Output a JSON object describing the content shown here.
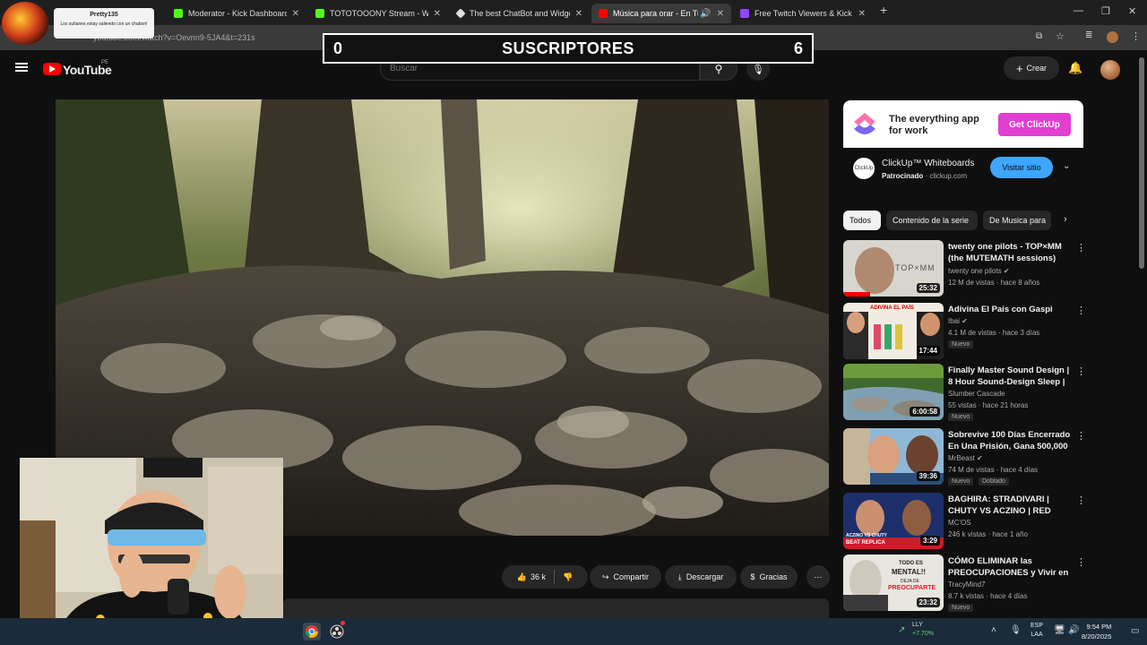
{
  "browser": {
    "tabs": [
      {
        "label": "Moderator - Kick Dashboard",
        "favicon_color": "#53fc18"
      },
      {
        "label": "TOTOTOOONY Stream - Watch",
        "favicon_color": "#53fc18"
      },
      {
        "label": "The best ChatBot and Widgets",
        "favicon_color": "#dddddd"
      },
      {
        "label": "Música para orar - En Tu p",
        "favicon_color": "#ff0000"
      },
      {
        "label": "Free Twitch Viewers & Kick Vie",
        "favicon_color": "#9146ff"
      }
    ],
    "url": "youtube.com/watch?v=Oevnn9-5JA4&t=231s"
  },
  "overlay": {
    "streamer_name": "Pretty135",
    "streamer_message": "Los sultanes estay saliendo con un chabon!",
    "sub_current": "0",
    "sub_label": "SUSCRIPTORES",
    "sub_goal": "6"
  },
  "youtube": {
    "brand": "YouTube",
    "country": "PE",
    "search_placeholder": "Buscar",
    "create_label": "Crear"
  },
  "actions": {
    "likes": "36 k",
    "share": "Compartir",
    "download": "Descargar",
    "thanks": "Gracias"
  },
  "ad": {
    "tagline": "The everything app for work",
    "cta": "Get ClickUp",
    "icon_text": "ClickUp",
    "title": "ClickUp™ Whiteboards",
    "sponsored": "Patrocinado",
    "domain": "clickup.com",
    "visit": "Visitar sitio"
  },
  "chips": [
    "Todos",
    "Contenido de la serie",
    "De Musica para"
  ],
  "recommendations": [
    {
      "title": "twenty one pilots - TOP×MM (the MUTEMATH sessions)",
      "channel": "twenty one pilots",
      "verified": true,
      "meta": "12 M de vistas · hace 8 años",
      "duration": "25:32",
      "badges": []
    },
    {
      "title": "Adivina El País con Gaspi",
      "channel": "Ibai",
      "verified": true,
      "meta": "4.1 M de vistas · hace 3 días",
      "duration": "17:44",
      "badges": [
        "Nuevo"
      ]
    },
    {
      "title": "Finally Master Sound Design | 8 Hour Sound-Design Sleep | ...",
      "channel": "Slumber Cascade",
      "verified": false,
      "meta": "55 vistas · hace 21 horas",
      "duration": "6:00:58",
      "badges": [
        "Nuevo"
      ]
    },
    {
      "title": "Sobrevive 100 Días Encerrado En Una Prisión, Gana 500,000 ...",
      "channel": "MrBeast",
      "verified": true,
      "meta": "74 M de vistas · hace 4 días",
      "duration": "39:36",
      "badges": [
        "Nuevo",
        "Doblado"
      ]
    },
    {
      "title": "BAGHIRA: STRADIVARI | CHUTY VS ACZINO | RED BULL ...",
      "channel": "MC'OS",
      "verified": false,
      "meta": "246 k vistas · hace 1 año",
      "duration": "3:29",
      "badges": []
    },
    {
      "title": "CÓMO ELIMINAR las PREOCUPACIONES y Vivir en ...",
      "channel": "TracyMind7",
      "verified": false,
      "meta": "8.7 k vistas · hace 4 días",
      "duration": "23:32",
      "badges": [
        "Nuevo"
      ]
    }
  ],
  "thumb_texts": {
    "t0": "TOP×MM",
    "t1": "ADIVINA EL PAÍS",
    "t4a": "ACZINO VS CHUTY",
    "t4b": "BEAT REPLICA",
    "t5a": "TODO ES",
    "t5b": "MENTAL!!",
    "t5c": "DEJA DE",
    "t5d": "PREOCUPARTE"
  },
  "taskbar": {
    "ticker_symbol": "LLY",
    "ticker_change": "+7.70%",
    "lang_top": "ESP",
    "lang_bottom": "LAA",
    "time": "9:54 PM",
    "date": "8/20/2025"
  },
  "colors": {
    "accent": "#3ea6ff",
    "brand": "#ff0000",
    "ad_cta": "#e23ed0",
    "webcam_border": "#4fd4ea"
  }
}
